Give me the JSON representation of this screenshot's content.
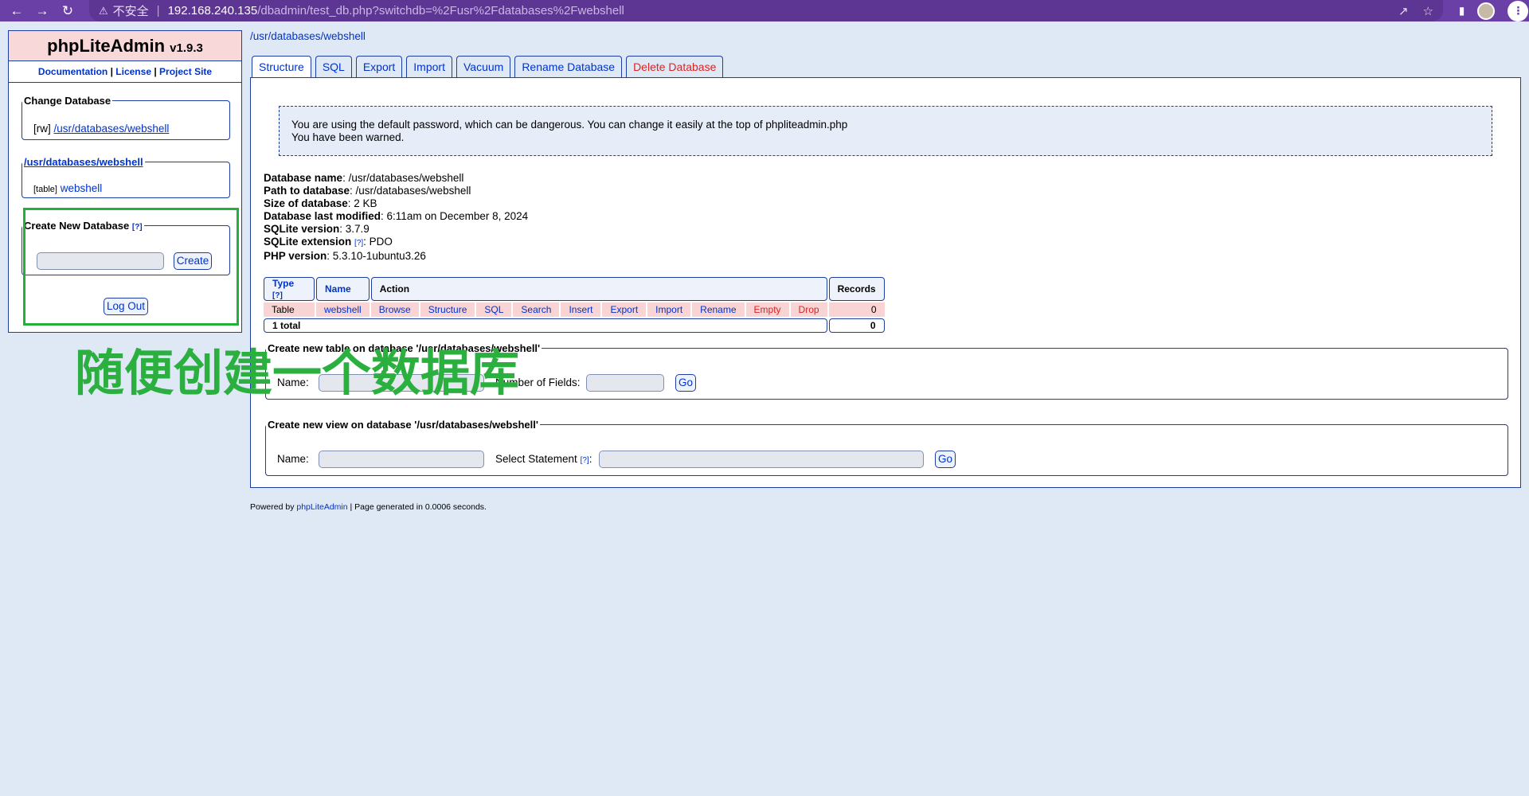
{
  "browser": {
    "insecure_label": "不安全",
    "separator": "|",
    "url_host": "192.168.240.135",
    "url_path": "/dbadmin/test_db.php?switchdb=%2Fusr%2Fdatabases%2Fwebshell"
  },
  "app": {
    "name": "phpLiteAdmin",
    "version": "v1.9.3",
    "links": [
      "Documentation",
      "License",
      "Project Site"
    ],
    "link_sep": "|"
  },
  "sidebar": {
    "change_db_legend": "Change Database",
    "db_mode": "[rw]",
    "db_path": "/usr/databases/webshell",
    "tables_legend": "/usr/databases/webshell",
    "table_kind": "[table]",
    "table_name": "webshell",
    "create_db_legend": "Create New Database",
    "help": "[?]",
    "create_button": "Create",
    "logout_button": "Log Out"
  },
  "annotation": {
    "text": "随便创建一个数据库",
    "color": "#2bb040"
  },
  "main": {
    "breadcrumb": "/usr/databases/webshell",
    "tabs": [
      "Structure",
      "SQL",
      "Export",
      "Import",
      "Vacuum",
      "Rename Database",
      "Delete Database"
    ],
    "warning_line1": "You are using the default password, which can be dangerous. You can change it easily at the top of phpliteadmin.php",
    "warning_line2": "You have been warned.",
    "info": [
      {
        "label": "Database name",
        "value": ": /usr/databases/webshell"
      },
      {
        "label": "Path to database",
        "value": ": /usr/databases/webshell"
      },
      {
        "label": "Size of database",
        "value": ": 2 KB"
      },
      {
        "label": "Database last modified",
        "value": ": 6:11am on December 8, 2024"
      },
      {
        "label": "SQLite version",
        "value": ": 3.7.9"
      },
      {
        "label": "SQLite extension",
        "value": ": PDO",
        "help": "[?]"
      },
      {
        "label": "PHP version",
        "value": ": 5.3.10-1ubuntu3.26"
      }
    ],
    "table": {
      "headers": {
        "type": "Type",
        "type_help": "[?]",
        "name": "Name",
        "action": "Action",
        "records": "Records"
      },
      "row": {
        "type": "Table",
        "name": "webshell",
        "actions": [
          "Browse",
          "Structure",
          "SQL",
          "Search",
          "Insert",
          "Export",
          "Import",
          "Rename",
          "Empty",
          "Drop"
        ],
        "records": "0"
      },
      "total_label": "1 total",
      "total_records": "0"
    },
    "new_table": {
      "legend": "Create new table on database '/usr/databases/webshell'",
      "name_label": "Name:",
      "fields_label": "Number of Fields:",
      "go": "Go"
    },
    "new_view": {
      "legend": "Create new view on database '/usr/databases/webshell'",
      "name_label": "Name:",
      "select_label": "Select Statement",
      "help": "[?]",
      "colon": ":",
      "go": "Go"
    }
  },
  "footer": {
    "powered_by": "Powered by",
    "link": "phpLiteAdmin",
    "rest": " | Page generated in 0.0006 seconds."
  }
}
